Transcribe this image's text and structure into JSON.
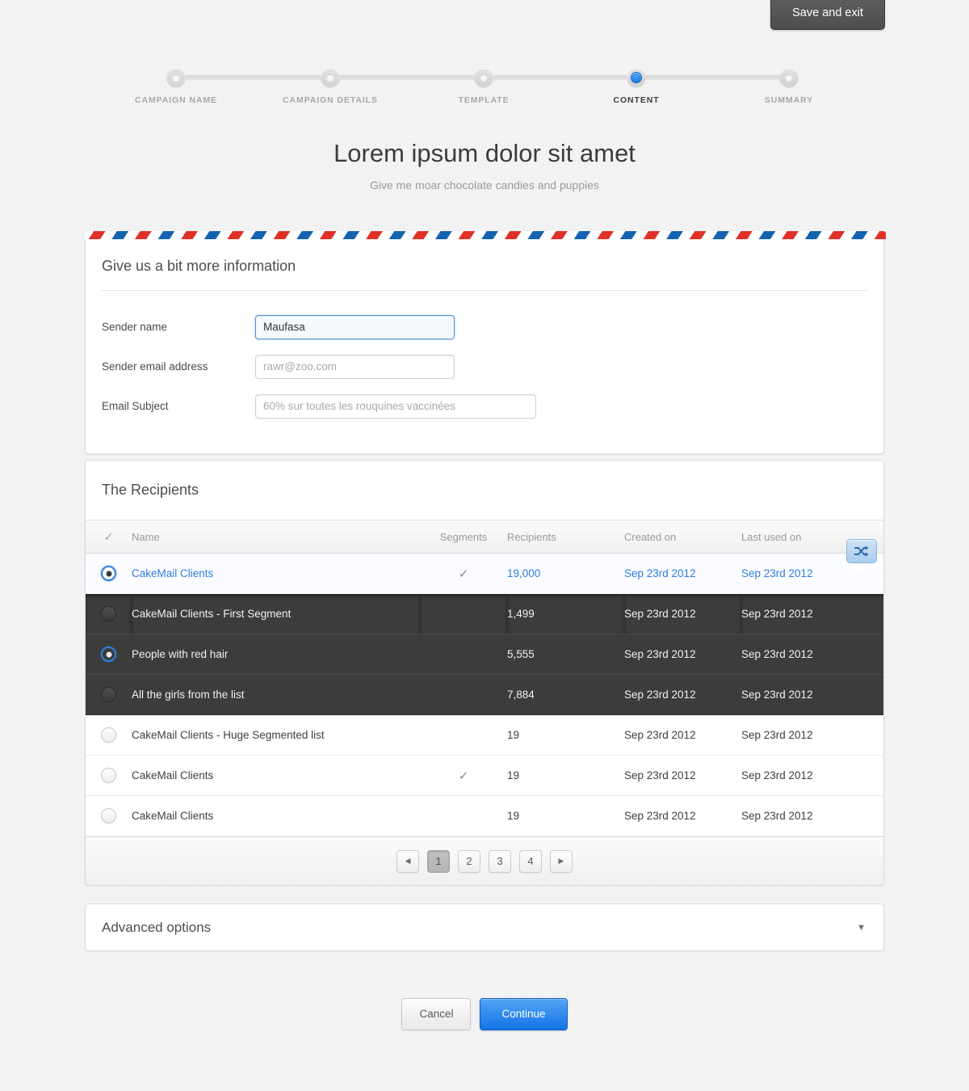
{
  "topbar": {
    "save_and_exit_label": "Save and exit"
  },
  "steps": [
    {
      "label": "CAMPAIGN NAME",
      "active": false
    },
    {
      "label": "CAMPAIGN DETAILS",
      "active": false
    },
    {
      "label": "TEMPLATE",
      "active": false
    },
    {
      "label": "CONTENT",
      "active": true
    },
    {
      "label": "SUMMARY",
      "active": false
    }
  ],
  "page": {
    "title": "Lorem ipsum dolor sit amet",
    "subtitle": "Give me moar chocolate candies and puppies"
  },
  "info_form": {
    "title": "Give us a bit more information",
    "fields": [
      {
        "label": "Sender name",
        "value": "Maufasa",
        "placeholder": "",
        "focused": true
      },
      {
        "label": "Sender email address",
        "value": "",
        "placeholder": "rawr@zoo.com",
        "focused": false
      },
      {
        "label": "Email Subject",
        "value": "",
        "placeholder": "60% sur toutes les rouquines vaccinées",
        "focused": false
      }
    ]
  },
  "recipients": {
    "title": "The Recipients",
    "columns": [
      "",
      "Name",
      "Segments",
      "Recipients",
      "Created on",
      "Last used on"
    ],
    "rows": [
      {
        "name": "CakeMail Clients",
        "segments": "✔",
        "recipients": "19,000",
        "created": "Sep 23rd 2012",
        "last_used": "Sep 23rd 2012",
        "selected": true,
        "style": "selected",
        "has_branch_button": true
      },
      {
        "name": "CakeMail Clients - First Segment",
        "segments": "",
        "recipients": "1,499",
        "created": "Sep 23rd 2012",
        "last_used": "Sep 23rd 2012",
        "selected": false,
        "style": "dark",
        "has_branch_button": false
      },
      {
        "name": "People with red hair",
        "segments": "",
        "recipients": "5,555",
        "created": "Sep 23rd 2012",
        "last_used": "Sep 23rd 2012",
        "selected": true,
        "style": "dark",
        "has_branch_button": false
      },
      {
        "name": "All the girls from the list",
        "segments": "",
        "recipients": "7,884",
        "created": "Sep 23rd 2012",
        "last_used": "Sep 23rd 2012",
        "selected": false,
        "style": "dark",
        "has_branch_button": false
      },
      {
        "name": "CakeMail Clients - Huge Segmented list",
        "segments": "",
        "recipients": "19",
        "created": "Sep 23rd 2012",
        "last_used": "Sep 23rd 2012",
        "selected": false,
        "style": "light",
        "has_branch_button": false
      },
      {
        "name": "CakeMail Clients",
        "segments": "✔",
        "recipients": "19",
        "created": "Sep 23rd 2012",
        "last_used": "Sep 23rd 2012",
        "selected": false,
        "style": "light",
        "has_branch_button": false
      },
      {
        "name": "CakeMail Clients",
        "segments": "",
        "recipients": "19",
        "created": "Sep 23rd 2012",
        "last_used": "Sep 23rd 2012",
        "selected": false,
        "style": "light",
        "has_branch_button": false
      }
    ],
    "header_select_all_icon": "check-icon",
    "branch_icon": "shuffle-icon",
    "pagination": {
      "prev_label": "◀",
      "next_label": "▶",
      "pages": [
        "1",
        "2",
        "3",
        "4"
      ],
      "current_page": "1"
    }
  },
  "advanced": {
    "title": "Advanced options",
    "caret": "▼"
  },
  "footer": {
    "cancel_label": "Cancel",
    "continue_label": "Continue"
  },
  "colors": {
    "accent_blue": "#2f7ee0",
    "dark_row": "#3c3c3c",
    "page_bg": "#f4f4f4",
    "airmail_red": "#e03128",
    "airmail_blue": "#1363b0"
  }
}
